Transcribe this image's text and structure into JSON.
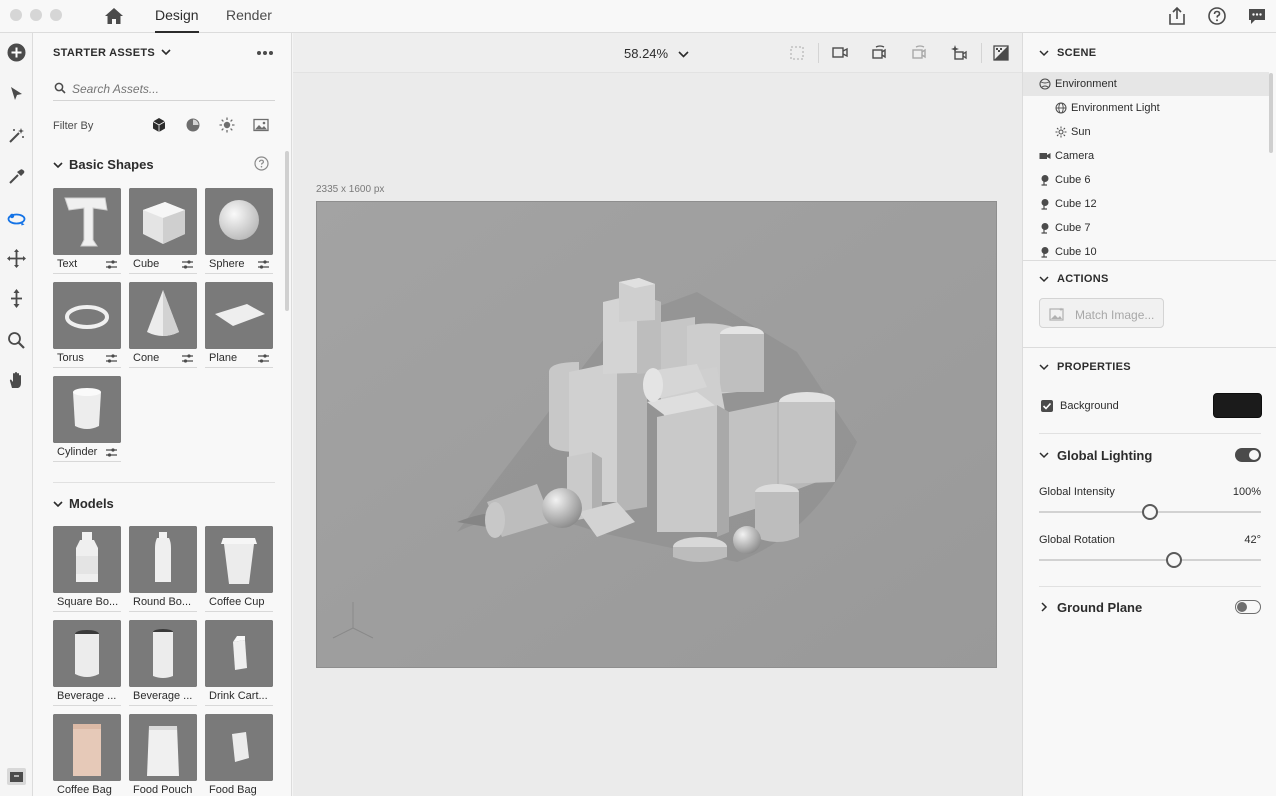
{
  "top_bar": {
    "tabs": [
      {
        "label": "Design",
        "active": true
      },
      {
        "label": "Render",
        "active": false
      }
    ],
    "icons": [
      "home-icon",
      "share-icon",
      "help-icon",
      "feedback-icon"
    ]
  },
  "toolbar": {
    "tools": [
      "add-icon",
      "select-icon",
      "magic-wand-icon",
      "eyedropper-icon",
      "orbit-icon",
      "move-icon",
      "dolly-icon",
      "zoom-icon",
      "hand-icon",
      "panel-toggle-icon"
    ]
  },
  "assets": {
    "title": "STARTER ASSETS",
    "search_placeholder": "Search Assets...",
    "filter_label": "Filter By",
    "basic_shapes": {
      "title": "Basic Shapes",
      "items": [
        "Text",
        "Cube",
        "Sphere",
        "Torus",
        "Cone",
        "Plane",
        "Cylinder"
      ]
    },
    "models": {
      "title": "Models",
      "items": [
        "Square Bo...",
        "Round Bo...",
        "Coffee Cup",
        "Beverage ...",
        "Beverage ...",
        "Drink Cart...",
        "Coffee Bag",
        "Food Pouch",
        "Food Bag"
      ]
    }
  },
  "canvas": {
    "zoom": "58.24%",
    "dimensions": "2335 x 1600 px"
  },
  "scene": {
    "title": "SCENE",
    "items": [
      {
        "label": "Environment",
        "icon": "environment-icon",
        "selected": true
      },
      {
        "label": "Environment Light",
        "icon": "globe-icon",
        "selected": false
      },
      {
        "label": "Sun",
        "icon": "sun-icon",
        "selected": false
      },
      {
        "label": "Camera",
        "icon": "camera-icon",
        "selected": false
      },
      {
        "label": "Cube 6",
        "icon": "object-icon",
        "selected": false
      },
      {
        "label": "Cube 12",
        "icon": "object-icon",
        "selected": false
      },
      {
        "label": "Cube 7",
        "icon": "object-icon",
        "selected": false
      },
      {
        "label": "Cube 10",
        "icon": "object-icon",
        "selected": false
      }
    ]
  },
  "actions": {
    "title": "ACTIONS",
    "match_image": "Match Image..."
  },
  "properties": {
    "title": "PROPERTIES",
    "background_label": "Background",
    "background_checked": true,
    "background_color": "#1b1b1b",
    "global_lighting": "Global Lighting",
    "global_lighting_on": true,
    "global_intensity_label": "Global Intensity",
    "global_intensity_value": "100%",
    "global_intensity_level": 0.5,
    "global_rotation_label": "Global Rotation",
    "global_rotation_value": "42°",
    "global_rotation_level": 0.61,
    "ground_plane": "Ground Plane",
    "ground_plane_on": false
  }
}
